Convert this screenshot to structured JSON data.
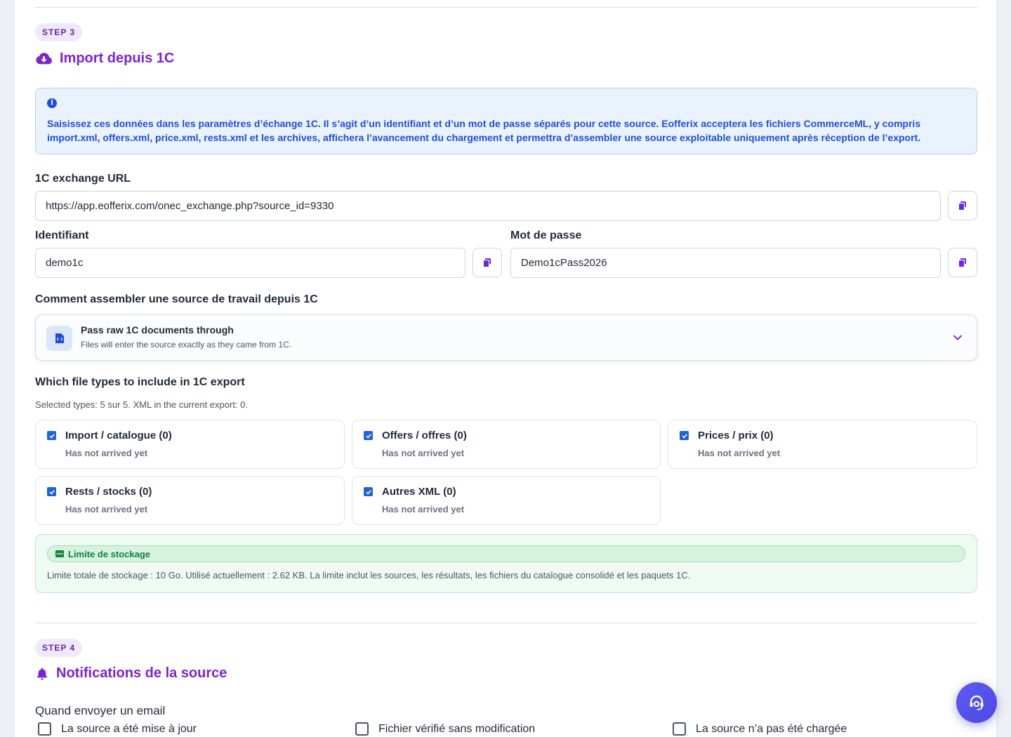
{
  "step3": {
    "badge": "STEP 3",
    "title": "Import depuis 1C",
    "title_icon": "cloud-download-icon",
    "info": "Saisissez ces données dans les paramètres d’échange 1C. Il s’agit d’un identifiant et d’un mot de passe séparés pour cette source. Eofferix acceptera les fichiers CommerceML, y compris import.xml, offers.xml, price.xml, rests.xml et les archives, affichera l’avancement du chargement et permettra d’assembler une source exploitable uniquement après réception de l’export.",
    "url_label": "1C exchange URL",
    "url_value": "https://app.eofferix.com/onec_exchange.php?source_id=9330",
    "login_label": "Identifiant",
    "login_value": "demo1c",
    "password_label": "Mot de passe",
    "password_value": "Demo1cPass2026",
    "assemble_label": "Comment assembler une source de travail depuis 1C",
    "assemble_selected_title": "Pass raw 1C documents through",
    "assemble_selected_sub": "Files will enter the source exactly as they came from 1C.",
    "types_label": "Which file types to include in 1C export",
    "types_hint": "Selected types: 5 sur 5. XML in the current export: 0.",
    "file_types": [
      {
        "label": "Import / catalogue  (0)",
        "status": "Has not arrived yet",
        "checked": true
      },
      {
        "label": "Offers / offres  (0)",
        "status": "Has not arrived yet",
        "checked": true
      },
      {
        "label": "Prices / prix  (0)",
        "status": "Has not arrived yet",
        "checked": true
      },
      {
        "label": "Rests / stocks  (0)",
        "status": "Has not arrived yet",
        "checked": true
      },
      {
        "label": "Autres XML  (0)",
        "status": "Has not arrived yet",
        "checked": true
      }
    ],
    "storage_title": "Limite de stockage",
    "storage_text": "Limite totale de stockage : 10 Go. Utilisé actuellement : 2.62 KB. La limite inclut les sources, les résultats, les fichiers du catalogue consolidé et les paquets 1C."
  },
  "step4": {
    "badge": "STEP 4",
    "title": "Notifications de la source",
    "title_icon": "bell-icon",
    "email_label": "Quand envoyer un email",
    "options": [
      {
        "label": "La source a été mise à jour",
        "checked": false
      },
      {
        "label": "Fichier vérifié sans modification",
        "checked": false
      },
      {
        "label": "La source n’a pas été chargée",
        "checked": false
      }
    ]
  },
  "colors": {
    "accent": "#7e22ce",
    "info_text": "#1d4ed8",
    "success": "#15803d",
    "support_button": "#4f46e5"
  }
}
